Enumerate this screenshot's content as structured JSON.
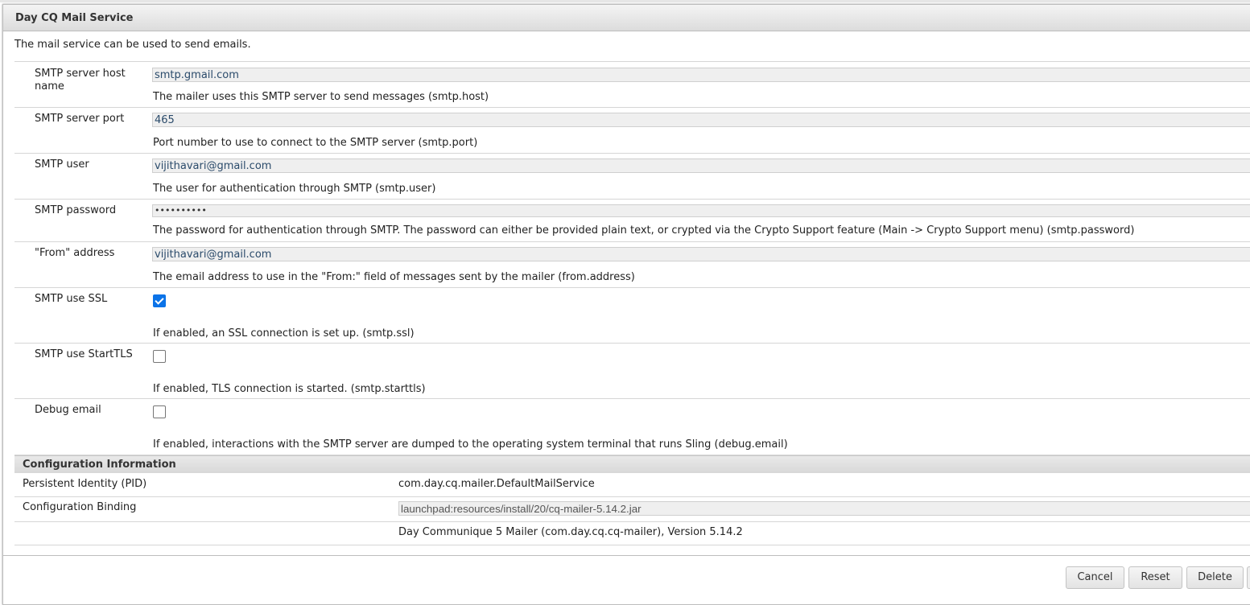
{
  "dialog": {
    "title": "Day CQ Mail Service",
    "description": "The mail service can be used to send emails."
  },
  "fields": {
    "host": {
      "label": "SMTP server host name",
      "value": "smtp.gmail.com",
      "hint": "The mailer uses this SMTP server to send messages (smtp.host)"
    },
    "port": {
      "label": "SMTP server port",
      "value": "465",
      "hint": "Port number to use to connect to the SMTP server (smtp.port)"
    },
    "user": {
      "label": "SMTP user",
      "value": "vijithavari@gmail.com",
      "hint": "The user for authentication through SMTP (smtp.user)"
    },
    "password": {
      "label": "SMTP password",
      "value": "••••••••••",
      "hint": "The password for authentication through SMTP. The password can either be provided plain text, or crypted via the Crypto Support feature (Main -> Crypto Support menu) (smtp.password)"
    },
    "from": {
      "label": "\"From\" address",
      "value": "vijithavari@gmail.com",
      "hint": "The email address to use in the \"From:\" field of messages sent by the mailer (from.address)"
    },
    "ssl": {
      "label": "SMTP use SSL",
      "checked": true,
      "hint": "If enabled, an SSL connection is set up. (smtp.ssl)"
    },
    "starttls": {
      "label": "SMTP use StartTLS",
      "checked": false,
      "hint": "If enabled, TLS connection is started. (smtp.starttls)"
    },
    "debug": {
      "label": "Debug email",
      "checked": false,
      "hint": "If enabled, interactions with the SMTP server are dumped to the operating system terminal that runs Sling (debug.email)"
    }
  },
  "config": {
    "heading": "Configuration Information",
    "pid_label": "Persistent Identity (PID)",
    "pid_value": "com.day.cq.mailer.DefaultMailService",
    "binding_label": "Configuration Binding",
    "binding_value": "launchpad:resources/install/20/cq-mailer-5.14.2.jar",
    "bundle_info": "Day Communique 5 Mailer (com.day.cq.cq-mailer), Version 5.14.2"
  },
  "buttons": {
    "cancel": "Cancel",
    "reset": "Reset",
    "delete": "Delete"
  }
}
